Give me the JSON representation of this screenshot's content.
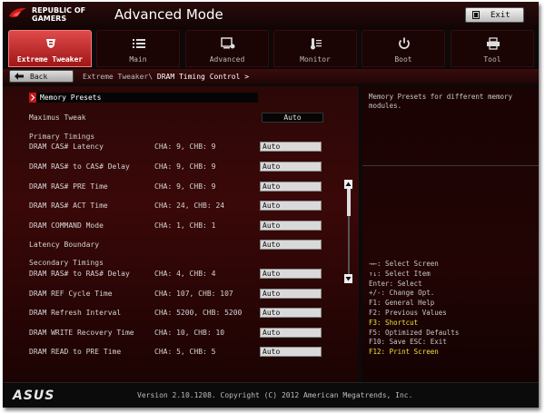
{
  "header": {
    "brand_line1": "REPUBLIC OF",
    "brand_line2": "GAMERS",
    "mode_title": "Advanced Mode",
    "exit_label": "Exit"
  },
  "tabs": [
    {
      "label": "Extreme Tweaker",
      "icon": "tweaker-icon",
      "active": true
    },
    {
      "label": "Main",
      "icon": "list-icon",
      "active": false
    },
    {
      "label": "Advanced",
      "icon": "advanced-icon",
      "active": false
    },
    {
      "label": "Monitor",
      "icon": "thermometer-icon",
      "active": false
    },
    {
      "label": "Boot",
      "icon": "power-icon",
      "active": false
    },
    {
      "label": "Tool",
      "icon": "printer-icon",
      "active": false
    }
  ],
  "nav": {
    "back_label": "Back",
    "breadcrumb_parent": "Extreme Tweaker\\",
    "breadcrumb_current": "DRAM Timing Control >"
  },
  "main": {
    "memory_presets": "Memory Presets",
    "maximus_tweak_label": "Maximus Tweak",
    "maximus_tweak_value": "Auto",
    "primary_header": "Primary Timings",
    "secondary_header": "Secondary Timings",
    "rows": [
      {
        "label": "DRAM CAS# Latency",
        "cha": "9",
        "chb": "9",
        "value": "Auto"
      },
      {
        "label": "DRAM RAS# to CAS# Delay",
        "cha": "9",
        "chb": "9",
        "value": "Auto"
      },
      {
        "label": "DRAM RAS# PRE Time",
        "cha": "9",
        "chb": "9",
        "value": "Auto"
      },
      {
        "label": "DRAM RAS# ACT Time",
        "cha": "24",
        "chb": "24",
        "value": "Auto"
      },
      {
        "label": "DRAM COMMAND Mode",
        "cha": "1",
        "chb": "1",
        "value": "Auto"
      },
      {
        "label": "Latency Boundary",
        "cha": "",
        "chb": "",
        "value": "Auto"
      },
      {
        "label": "DRAM RAS# to RAS# Delay",
        "cha": "4",
        "chb": "4",
        "value": "Auto"
      },
      {
        "label": "DRAM REF Cycle Time",
        "cha": "107",
        "chb": "107",
        "value": "Auto"
      },
      {
        "label": "DRAM Refresh Interval",
        "cha": "5200",
        "chb": "5200",
        "value": "Auto"
      },
      {
        "label": "DRAM WRITE Recovery Time",
        "cha": "10",
        "chb": "10",
        "value": "Auto"
      },
      {
        "label": "DRAM READ to PRE Time",
        "cha": "5",
        "chb": "5",
        "value": "Auto"
      }
    ]
  },
  "help": {
    "text": "Memory Presets for different memory modules.",
    "keys": [
      {
        "text": "→←: Select Screen",
        "highlight": false
      },
      {
        "text": "↑↓: Select Item",
        "highlight": false
      },
      {
        "text": "Enter: Select",
        "highlight": false
      },
      {
        "text": "+/-: Change Opt.",
        "highlight": false
      },
      {
        "text": "F1: General Help",
        "highlight": false
      },
      {
        "text": "F2: Previous Values",
        "highlight": false
      },
      {
        "text": "F3: Shortcut",
        "highlight": true
      },
      {
        "text": "F5: Optimized Defaults",
        "highlight": false
      },
      {
        "text": "F10: Save  ESC: Exit",
        "highlight": false
      },
      {
        "text": "F12: Print Screen",
        "highlight": true
      }
    ]
  },
  "footer": {
    "logo": "ASUS",
    "version": "Version 2.10.1208. Copyright (C) 2012 American Megatrends, Inc."
  }
}
